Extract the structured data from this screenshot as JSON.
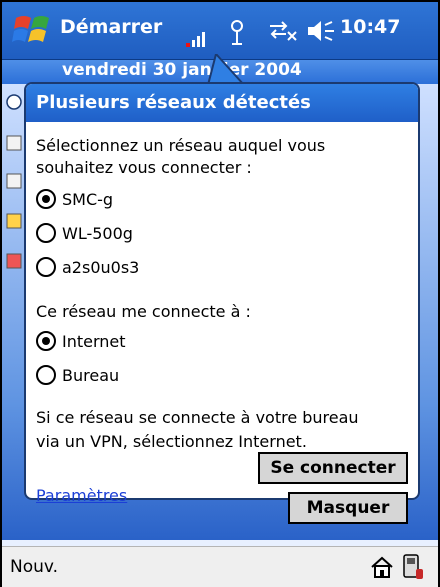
{
  "taskbar": {
    "start_label": "Démarrer",
    "time": "10:47"
  },
  "today": {
    "date": "vendredi 30 janvier 2004"
  },
  "dialog": {
    "title": "Plusieurs réseaux détectés",
    "prompt_line1": "Sélectionnez un réseau auquel vous",
    "prompt_line2": "souhaitez vous connecter :",
    "networks": [
      {
        "label": "SMC-g",
        "selected": true
      },
      {
        "label": "WL-500g",
        "selected": false
      },
      {
        "label": "a2s0u0s3",
        "selected": false
      }
    ],
    "connects_to_label": "Ce réseau me connecte à :",
    "destinations": [
      {
        "label": "Internet",
        "selected": true
      },
      {
        "label": "Bureau",
        "selected": false
      }
    ],
    "info_line1": "Si ce réseau se connecte à votre bureau",
    "info_line2": "via un VPN, sélectionnez Internet.",
    "connect_button": "Se connecter",
    "hide_button": "Masquer",
    "settings_link": "Paramètres"
  },
  "bottombar": {
    "new_label": "Nouv."
  }
}
